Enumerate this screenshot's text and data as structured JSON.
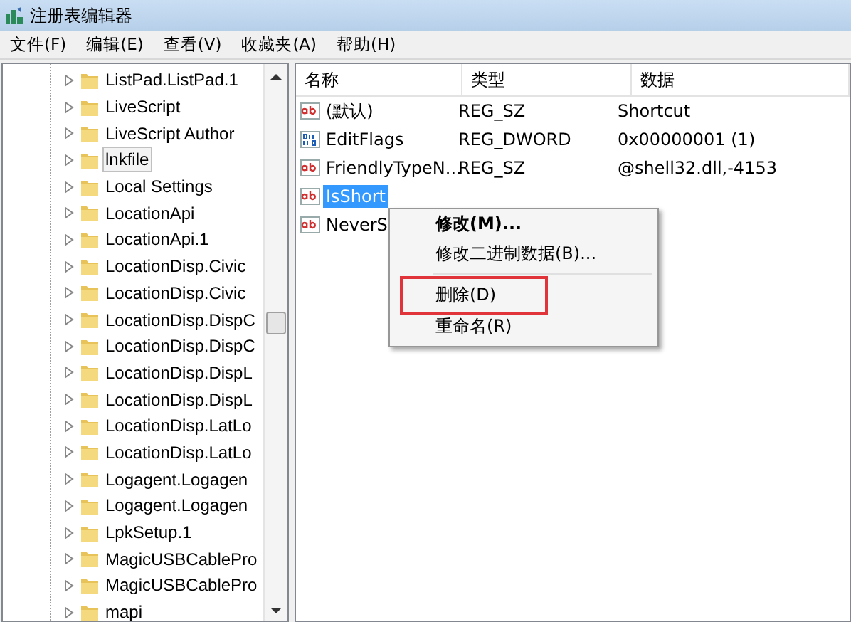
{
  "window": {
    "title": "注册表编辑器"
  },
  "menu": [
    "文件(F)",
    "编辑(E)",
    "查看(V)",
    "收藏夹(A)",
    "帮助(H)"
  ],
  "tree": {
    "items": [
      {
        "label": "ListPad.ListPad.1",
        "selected": false
      },
      {
        "label": "LiveScript",
        "selected": false
      },
      {
        "label": "LiveScript Author",
        "selected": false
      },
      {
        "label": "lnkfile",
        "selected": true
      },
      {
        "label": "Local Settings",
        "selected": false
      },
      {
        "label": "LocationApi",
        "selected": false
      },
      {
        "label": "LocationApi.1",
        "selected": false
      },
      {
        "label": "LocationDisp.Civic",
        "selected": false
      },
      {
        "label": "LocationDisp.Civic",
        "selected": false
      },
      {
        "label": "LocationDisp.DispC",
        "selected": false
      },
      {
        "label": "LocationDisp.DispC",
        "selected": false
      },
      {
        "label": "LocationDisp.DispL",
        "selected": false
      },
      {
        "label": "LocationDisp.DispL",
        "selected": false
      },
      {
        "label": "LocationDisp.LatLo",
        "selected": false
      },
      {
        "label": "LocationDisp.LatLo",
        "selected": false
      },
      {
        "label": "Logagent.Logagen",
        "selected": false
      },
      {
        "label": "Logagent.Logagen",
        "selected": false
      },
      {
        "label": "LpkSetup.1",
        "selected": false
      },
      {
        "label": "MagicUSBCablePro",
        "selected": false
      },
      {
        "label": "MagicUSBCablePro",
        "selected": false
      },
      {
        "label": "mapi",
        "selected": false
      }
    ]
  },
  "table": {
    "columns": [
      "名称",
      "类型",
      "数据"
    ],
    "rows": [
      {
        "kind": "string",
        "name": "(默认)",
        "type": "REG_SZ",
        "data": "Shortcut",
        "selected": false
      },
      {
        "kind": "binary",
        "name": "EditFlags",
        "type": "REG_DWORD",
        "data": "0x00000001 (1)",
        "selected": false
      },
      {
        "kind": "string",
        "name": "FriendlyTypeN...",
        "type": "REG_SZ",
        "data": "@shell32.dll,-4153",
        "selected": false
      },
      {
        "kind": "string",
        "name": "IsShort",
        "selected": true
      },
      {
        "kind": "string",
        "name": "NeverS",
        "selected": false
      }
    ]
  },
  "context_menu": {
    "items": [
      {
        "kind": "item",
        "label": "修改(M)...",
        "bold": true,
        "highlighted": false
      },
      {
        "kind": "item",
        "label": "修改二进制数据(B)...",
        "bold": false,
        "highlighted": false
      },
      {
        "kind": "separator"
      },
      {
        "kind": "item",
        "label": "删除(D)",
        "bold": false,
        "highlighted": true
      },
      {
        "kind": "item",
        "label": "重命名(R)",
        "bold": false,
        "highlighted": false
      }
    ]
  }
}
